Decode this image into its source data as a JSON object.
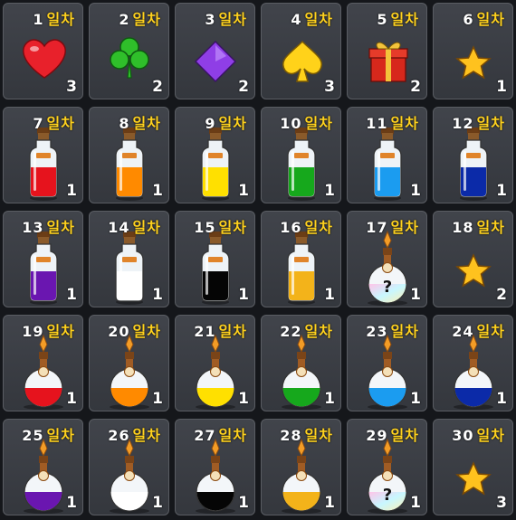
{
  "day_suffix": "일차",
  "colors": {
    "red": "#e6131d",
    "orange": "#ff8a00",
    "yellow": "#ffe000",
    "green": "#16a81c",
    "blue": "#1b9cf0",
    "navy": "#0b2aa8",
    "purple": "#6a16b0",
    "white": "#ffffff",
    "black": "#050505",
    "gold": "#f3b31a"
  },
  "rewards": [
    {
      "day": "1",
      "qty": "3",
      "icon": "heart-icon"
    },
    {
      "day": "2",
      "qty": "2",
      "icon": "clover-icon"
    },
    {
      "day": "3",
      "qty": "2",
      "icon": "diamond-icon"
    },
    {
      "day": "4",
      "qty": "3",
      "icon": "spade-icon"
    },
    {
      "day": "5",
      "qty": "2",
      "icon": "gift-box-icon"
    },
    {
      "day": "6",
      "qty": "1",
      "icon": "star-icon"
    },
    {
      "day": "7",
      "qty": "1",
      "icon": "potion-bottle-icon",
      "color": "red"
    },
    {
      "day": "8",
      "qty": "1",
      "icon": "potion-bottle-icon",
      "color": "orange"
    },
    {
      "day": "9",
      "qty": "1",
      "icon": "potion-bottle-icon",
      "color": "yellow"
    },
    {
      "day": "10",
      "qty": "1",
      "icon": "potion-bottle-icon",
      "color": "green"
    },
    {
      "day": "11",
      "qty": "1",
      "icon": "potion-bottle-icon",
      "color": "blue"
    },
    {
      "day": "12",
      "qty": "1",
      "icon": "potion-bottle-icon",
      "color": "navy"
    },
    {
      "day": "13",
      "qty": "1",
      "icon": "potion-bottle-icon",
      "color": "purple"
    },
    {
      "day": "14",
      "qty": "1",
      "icon": "potion-bottle-icon",
      "color": "white"
    },
    {
      "day": "15",
      "qty": "1",
      "icon": "potion-bottle-icon",
      "color": "black"
    },
    {
      "day": "16",
      "qty": "1",
      "icon": "potion-bottle-icon",
      "color": "gold"
    },
    {
      "day": "17",
      "qty": "1",
      "icon": "mystery-flask-icon"
    },
    {
      "day": "18",
      "qty": "2",
      "icon": "star-icon"
    },
    {
      "day": "19",
      "qty": "1",
      "icon": "round-flask-icon",
      "color": "red"
    },
    {
      "day": "20",
      "qty": "1",
      "icon": "round-flask-icon",
      "color": "orange"
    },
    {
      "day": "21",
      "qty": "1",
      "icon": "round-flask-icon",
      "color": "yellow"
    },
    {
      "day": "22",
      "qty": "1",
      "icon": "round-flask-icon",
      "color": "green"
    },
    {
      "day": "23",
      "qty": "1",
      "icon": "round-flask-icon",
      "color": "blue"
    },
    {
      "day": "24",
      "qty": "1",
      "icon": "round-flask-icon",
      "color": "navy"
    },
    {
      "day": "25",
      "qty": "1",
      "icon": "round-flask-icon",
      "color": "purple"
    },
    {
      "day": "26",
      "qty": "1",
      "icon": "round-flask-icon",
      "color": "white"
    },
    {
      "day": "27",
      "qty": "1",
      "icon": "round-flask-icon",
      "color": "black"
    },
    {
      "day": "28",
      "qty": "1",
      "icon": "round-flask-icon",
      "color": "gold"
    },
    {
      "day": "29",
      "qty": "1",
      "icon": "mystery-flask-icon"
    },
    {
      "day": "30",
      "qty": "3",
      "icon": "star-icon"
    }
  ]
}
